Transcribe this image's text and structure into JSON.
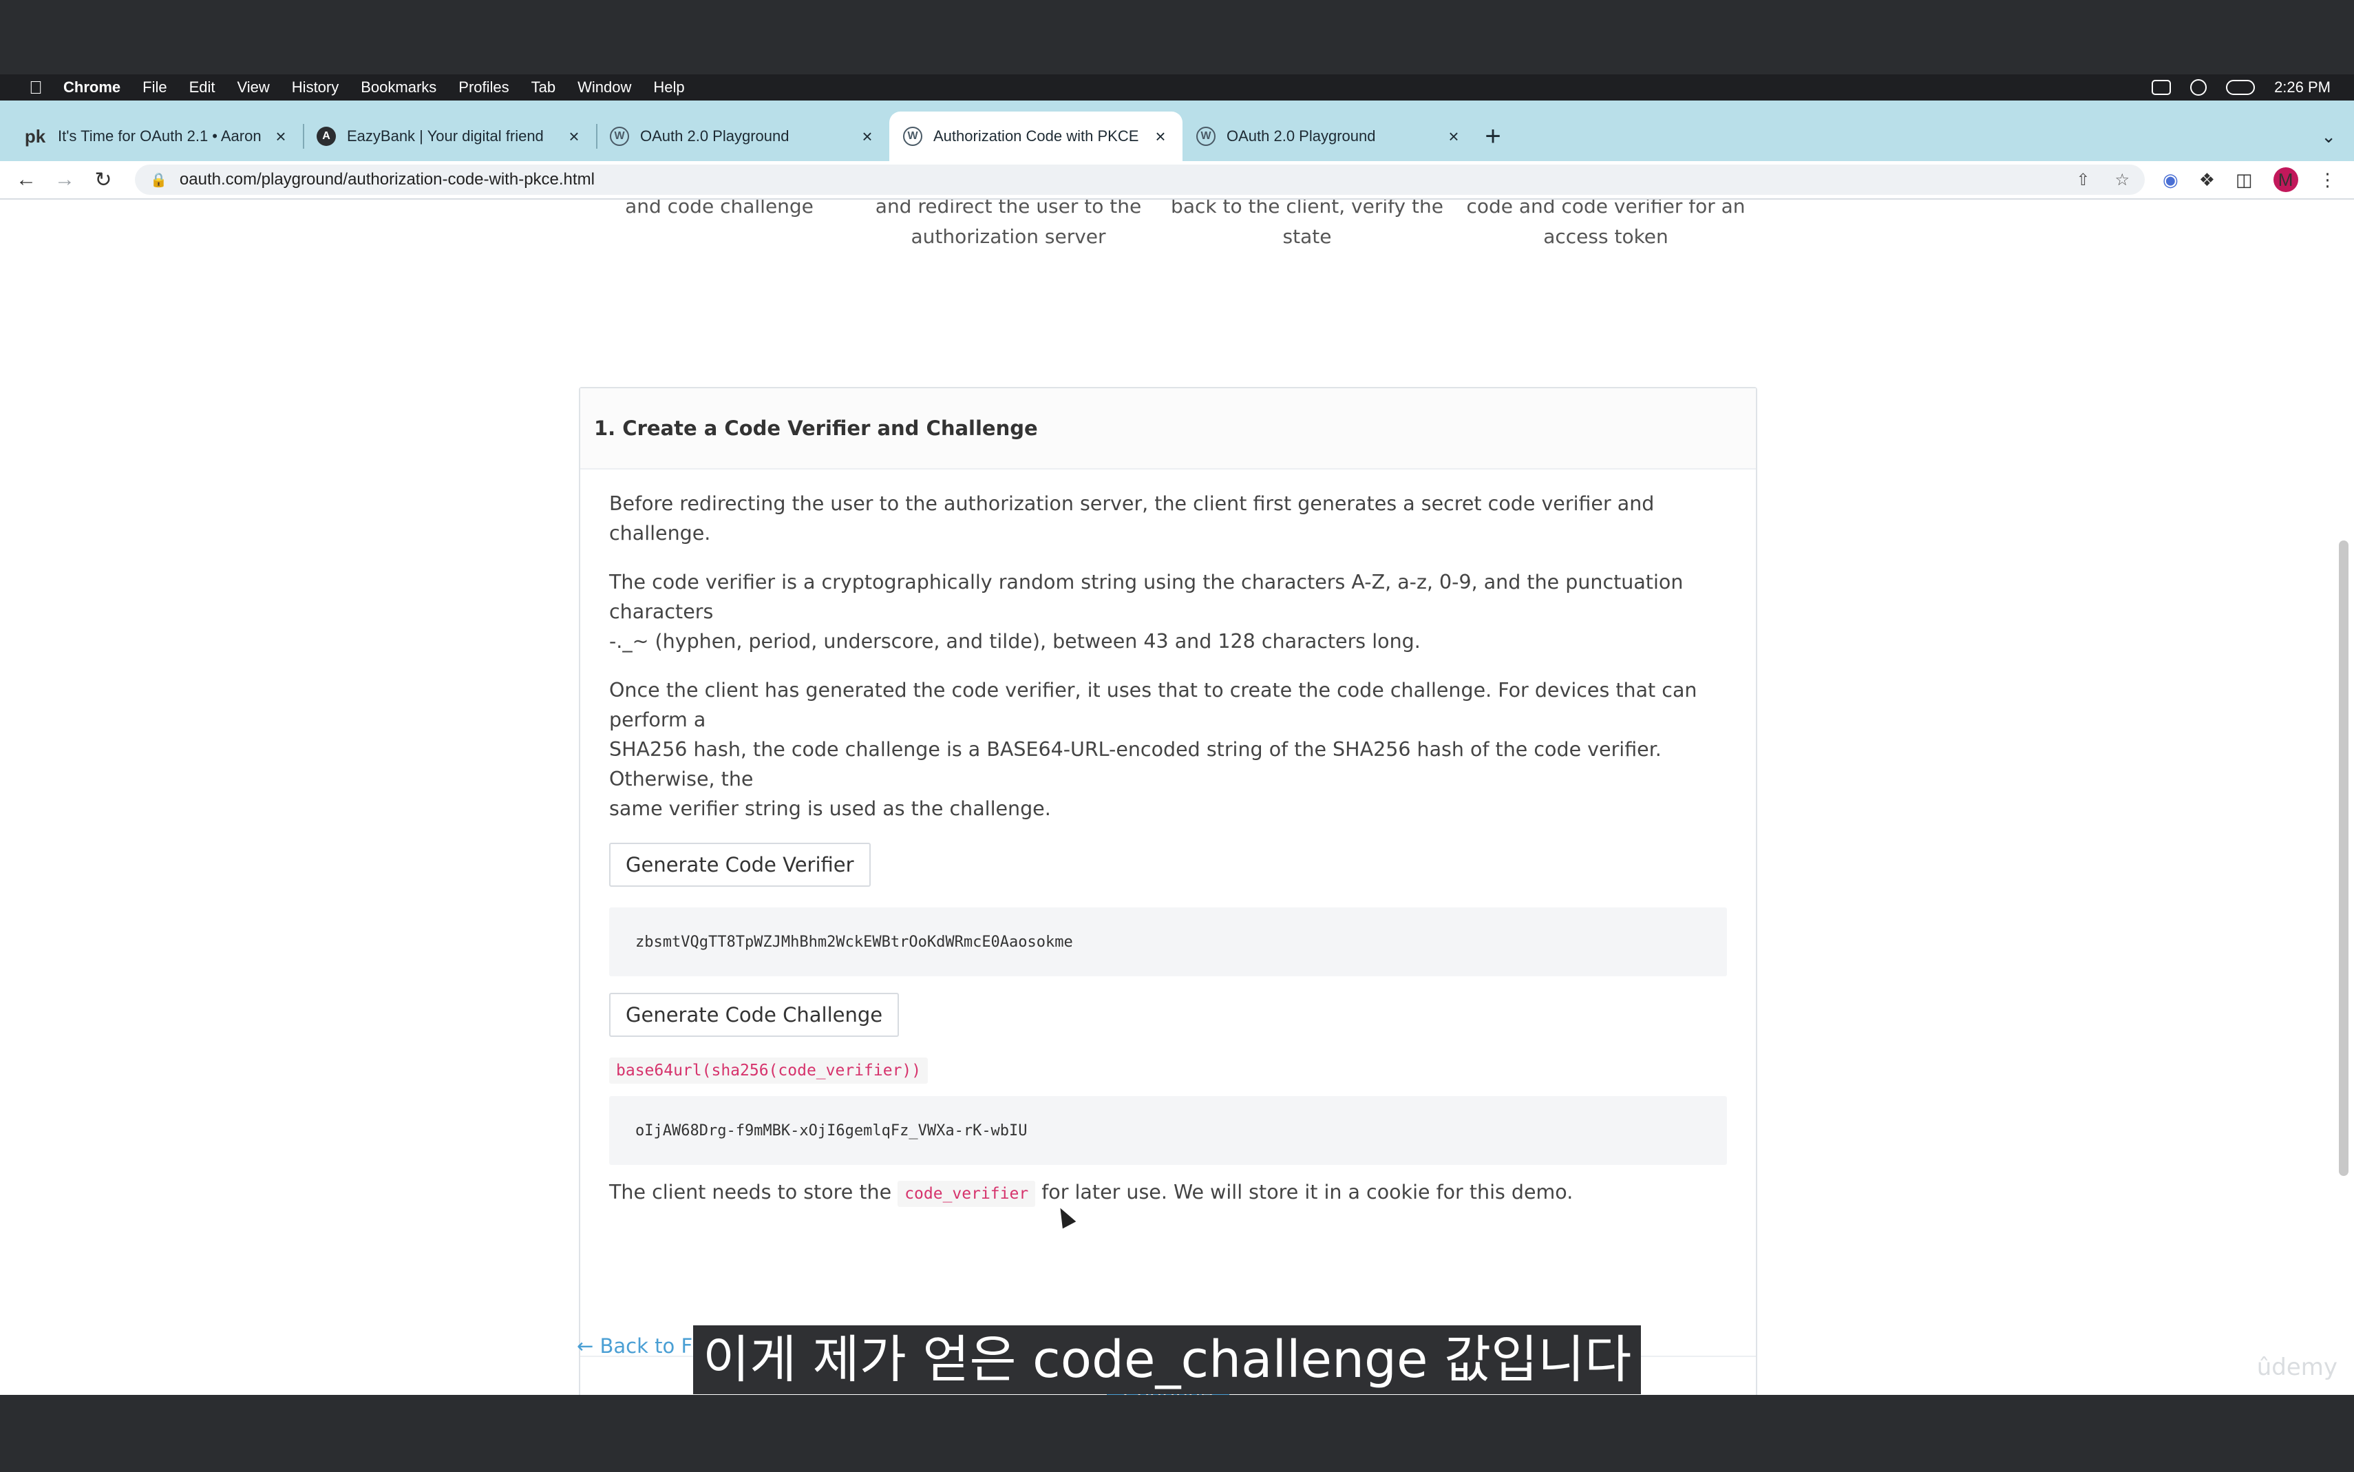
{
  "menubar": {
    "app": "Chrome",
    "items": [
      "File",
      "Edit",
      "View",
      "History",
      "Bookmarks",
      "Profiles",
      "Tab",
      "Window",
      "Help"
    ],
    "clock": "2:26 PM"
  },
  "tabs": [
    {
      "title": "It's Time for OAuth 2.1 • Aaron",
      "favicon": "pk",
      "active": false
    },
    {
      "title": "EazyBank | Your digital friend",
      "favicon": "angular-icon",
      "active": false
    },
    {
      "title": "OAuth 2.0 Playground",
      "favicon": "wordpress-icon",
      "active": false
    },
    {
      "title": "Authorization Code with PKCE",
      "favicon": "wordpress-icon",
      "active": true
    },
    {
      "title": "OAuth 2.0 Playground",
      "favicon": "wordpress-icon",
      "active": false
    }
  ],
  "address": {
    "url": "oauth.com/playground/authorization-code-with-pkce.html"
  },
  "profile_initial": "M",
  "steps_partial": [
    {
      "lines": [
        "and code challenge"
      ]
    },
    {
      "lines": [
        "and redirect the user to the",
        "authorization server"
      ]
    },
    {
      "lines": [
        "back to the client, verify the",
        "state"
      ]
    },
    {
      "lines": [
        "code and code verifier for an",
        "access token"
      ]
    }
  ],
  "card": {
    "title": "1. Create a Code Verifier and Challenge",
    "para1": "Before redirecting the user to the authorization server, the client first generates a secret code verifier and challenge.",
    "para2_line1": "The code verifier is a cryptographically random string using the characters A-Z, a-z, 0-9, and the punctuation characters",
    "para2_line2": "-._~ (hyphen, period, underscore, and tilde), between 43 and 128 characters long.",
    "para3_line1": "Once the client has generated the code verifier, it uses that to create the code challenge. For devices that can perform a",
    "para3_line2": "SHA256 hash, the code challenge is a BASE64-URL-encoded string of the SHA256 hash of the code verifier. Otherwise, the",
    "para3_line3": "same verifier string is used as the challenge.",
    "generate_verifier_label": "Generate Code Verifier",
    "code_verifier": "zbsmtVQgTT8TpWZJMhBhm2WckEWBtrOoKdWRmcE0Aaosokme",
    "generate_challenge_label": "Generate Code Challenge",
    "formula": "base64url(sha256(code_verifier))",
    "code_challenge": "oIjAW68Drg-f9mMBK-xOjI6gemlqFz_VWXa-rK-wbIU",
    "store_prefix": "The client needs to store the",
    "store_code": "code_verifier",
    "store_suffix": "for later use. We will store it in a cookie for this demo.",
    "continue_label": "Continue"
  },
  "back_link": "← Back to Fl",
  "subtitle": "이게 제가 얻은 code_challenge 값입니다",
  "watermark": "ûdemy"
}
